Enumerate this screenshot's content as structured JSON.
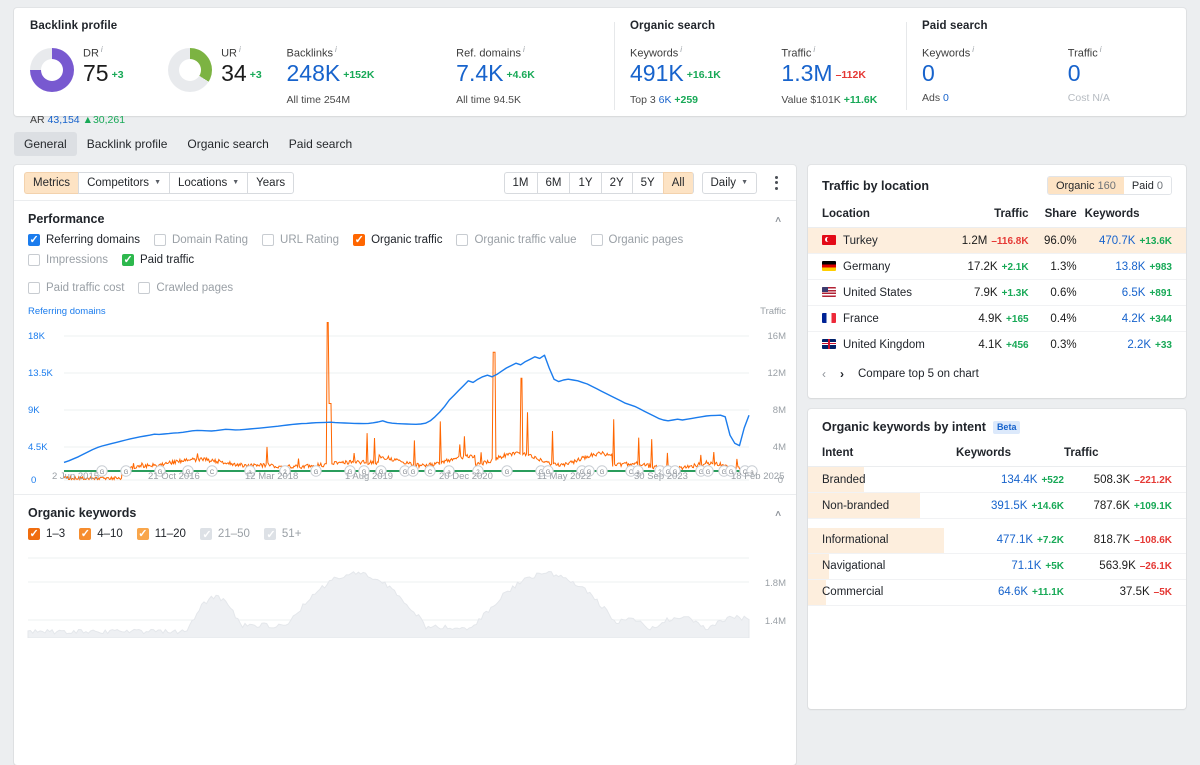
{
  "overview": {
    "groups": [
      {
        "title": "Backlink profile",
        "metrics": [
          {
            "label": "DR",
            "info": "i",
            "value": "75",
            "delta": "+3",
            "delta_dir": "up",
            "gauge_pct": 75,
            "gauge_color": "#7859d0",
            "sub_prefix": "AR",
            "sub_value": "43,154",
            "sub_delta": "▲30,261"
          },
          {
            "label": "UR",
            "info": "i",
            "value": "34",
            "delta": "+3",
            "delta_dir": "up",
            "gauge_pct": 34,
            "gauge_color": "#7cb342"
          },
          {
            "label": "Backlinks",
            "info": "i",
            "value": "248K",
            "delta": "+152K",
            "delta_dir": "up",
            "value_color": "blue",
            "sub_prefix": "All time",
            "sub_value": "254M"
          },
          {
            "label": "Ref. domains",
            "info": "i",
            "value": "7.4K",
            "delta": "+4.6K",
            "delta_dir": "up",
            "value_color": "blue",
            "sub_prefix": "All time",
            "sub_value": "94.5K"
          }
        ]
      },
      {
        "title": "Organic search",
        "metrics": [
          {
            "label": "Keywords",
            "info": "i",
            "value": "491K",
            "delta": "+16.1K",
            "delta_dir": "up",
            "value_color": "blue",
            "sub_prefix": "Top 3",
            "sub_value": "6K",
            "sub_delta": "+259"
          },
          {
            "label": "Traffic",
            "info": "i",
            "value": "1.3M",
            "delta": "–112K",
            "delta_dir": "down",
            "value_color": "blue",
            "sub_prefix": "Value",
            "sub_value": "$101K",
            "sub_delta": "+11.6K"
          }
        ]
      },
      {
        "title": "Paid search",
        "metrics": [
          {
            "label": "Keywords",
            "info": "i",
            "value": "0",
            "value_color": "blue",
            "sub_prefix": "Ads",
            "sub_value": "0"
          },
          {
            "label": "Traffic",
            "info": "i",
            "value": "0",
            "value_color": "blue",
            "sub_prefix": "Cost",
            "sub_value": "N/A",
            "sub_muted": true
          }
        ]
      }
    ]
  },
  "tabs": [
    {
      "label": "General",
      "active": true
    },
    {
      "label": "Backlink profile",
      "active": false
    },
    {
      "label": "Organic search",
      "active": false
    },
    {
      "label": "Paid search",
      "active": false
    }
  ],
  "toolbar": {
    "left_buttons": [
      {
        "label": "Metrics",
        "amber": true,
        "caret": false
      },
      {
        "label": "Competitors",
        "amber": false,
        "caret": true
      },
      {
        "label": "Locations",
        "amber": false,
        "caret": true
      },
      {
        "label": "Years",
        "amber": false,
        "caret": false
      }
    ],
    "ranges": [
      {
        "label": "1M",
        "active": false
      },
      {
        "label": "6M",
        "active": false
      },
      {
        "label": "1Y",
        "active": false
      },
      {
        "label": "2Y",
        "active": false
      },
      {
        "label": "5Y",
        "active": false
      },
      {
        "label": "All",
        "active": true
      }
    ],
    "granularity": {
      "label": "Daily",
      "caret": "▼"
    },
    "kebab": "more-options"
  },
  "performance": {
    "title": "Performance",
    "collapse_icon": "∧",
    "checkboxes": [
      {
        "label": "Referring domains",
        "checked": true,
        "color": "#1b7ced"
      },
      {
        "label": "Domain Rating",
        "checked": false,
        "color": ""
      },
      {
        "label": "URL Rating",
        "checked": false,
        "color": ""
      },
      {
        "label": "Organic traffic",
        "checked": true,
        "color": "#ff6600"
      },
      {
        "label": "Organic traffic value",
        "checked": false,
        "color": ""
      },
      {
        "label": "Organic pages",
        "checked": false,
        "color": ""
      },
      {
        "label": "Impressions",
        "checked": false,
        "color": ""
      },
      {
        "label": "Paid traffic",
        "checked": true,
        "color": "#2db84d"
      },
      {
        "label": "Paid traffic cost",
        "checked": false,
        "color": ""
      },
      {
        "label": "Crawled pages",
        "checked": false,
        "color": ""
      }
    ]
  },
  "organic_keywords": {
    "title": "Organic keywords",
    "collapse_icon": "∧",
    "checkboxes": [
      {
        "label": "1–3",
        "checked": true,
        "dim": false
      },
      {
        "label": "4–10",
        "checked": true,
        "dim": false
      },
      {
        "label": "11–20",
        "checked": true,
        "dim": false
      },
      {
        "label": "21–50",
        "checked": true,
        "dim": true
      },
      {
        "label": "51+",
        "checked": true,
        "dim": true
      }
    ],
    "y_labels": [
      "1.8M",
      "1.4M"
    ]
  },
  "traffic_by_location": {
    "title": "Traffic by location",
    "toggle": [
      {
        "label": "Organic",
        "count": "160",
        "active": true
      },
      {
        "label": "Paid",
        "count": "0",
        "active": false
      }
    ],
    "columns": [
      "Location",
      "Traffic",
      "Share",
      "Keywords"
    ],
    "rows": [
      {
        "flag": "tr",
        "location": "Turkey",
        "traffic": "1.2M",
        "traffic_delta": "–116.8K",
        "traffic_dir": "down",
        "share": "96.0%",
        "keywords": "470.7K",
        "kw_delta": "+13.6K",
        "kw_dir": "up",
        "highlight": true
      },
      {
        "flag": "de",
        "location": "Germany",
        "traffic": "17.2K",
        "traffic_delta": "+2.1K",
        "traffic_dir": "up",
        "share": "1.3%",
        "keywords": "13.8K",
        "kw_delta": "+983",
        "kw_dir": "up",
        "highlight": false
      },
      {
        "flag": "us",
        "location": "United States",
        "traffic": "7.9K",
        "traffic_delta": "+1.3K",
        "traffic_dir": "up",
        "share": "0.6%",
        "keywords": "6.5K",
        "kw_delta": "+891",
        "kw_dir": "up",
        "highlight": false
      },
      {
        "flag": "fr",
        "location": "France",
        "traffic": "4.9K",
        "traffic_delta": "+165",
        "traffic_dir": "up",
        "share": "0.4%",
        "keywords": "4.2K",
        "kw_delta": "+344",
        "kw_dir": "up",
        "highlight": false
      },
      {
        "flag": "gb",
        "location": "United Kingdom",
        "traffic": "4.1K",
        "traffic_delta": "+456",
        "traffic_dir": "up",
        "share": "0.3%",
        "keywords": "2.2K",
        "kw_delta": "+33",
        "kw_dir": "up",
        "highlight": false
      }
    ],
    "pager": {
      "prev": "‹",
      "next": "›",
      "label": "Compare top 5 on chart"
    }
  },
  "organic_keywords_by_intent": {
    "title": "Organic keywords by intent",
    "badge": "Beta",
    "columns": [
      "Intent",
      "Keywords",
      "Traffic"
    ],
    "rows": [
      {
        "intent": "Branded",
        "keywords": "134.4K",
        "kw_delta": "+522",
        "kw_dir": "up",
        "traffic": "508.3K",
        "tr_delta": "–221.2K",
        "tr_dir": "down",
        "bar_pct": 38
      },
      {
        "intent": "Non-branded",
        "keywords": "391.5K",
        "kw_delta": "+14.6K",
        "kw_dir": "up",
        "traffic": "787.6K",
        "tr_delta": "+109.1K",
        "tr_dir": "up",
        "bar_pct": 76
      },
      {
        "intent": "Informational",
        "keywords": "477.1K",
        "kw_delta": "+7.2K",
        "kw_dir": "up",
        "traffic": "818.7K",
        "tr_delta": "–108.6K",
        "tr_dir": "down",
        "bar_pct": 92
      },
      {
        "intent": "Navigational",
        "keywords": "71.1K",
        "kw_delta": "+5K",
        "kw_dir": "up",
        "traffic": "563.9K",
        "tr_delta": "–26.1K",
        "tr_dir": "down",
        "bar_pct": 14
      },
      {
        "intent": "Commercial",
        "keywords": "64.6K",
        "kw_delta": "+11.1K",
        "kw_dir": "up",
        "traffic": "37.5K",
        "tr_delta": "–5K",
        "tr_dir": "down",
        "bar_pct": 12
      }
    ]
  },
  "chart_data": {
    "type": "line",
    "title": "Performance",
    "legend_left": "Referring domains",
    "legend_right": "Traffic",
    "ylabel_left": "Referring domains",
    "ylabel_right": "Traffic",
    "ylim_left": [
      0,
      18000
    ],
    "yticks_left": [
      "0",
      "4.5K",
      "9K",
      "13.5K",
      "18K"
    ],
    "ylim_right": [
      0,
      16000000
    ],
    "yticks_right": [
      "0",
      "4M",
      "8M",
      "12M",
      "16M"
    ],
    "xlabel": "",
    "xticks": [
      "2 Jun 2015",
      "21 Oct 2016",
      "12 Mar 2018",
      "1 Aug 2019",
      "20 Dec 2020",
      "11 May 2022",
      "30 Sep 2023",
      "18 Feb 2025"
    ],
    "grid": true,
    "legend_position": "top",
    "series": [
      {
        "name": "Referring domains",
        "color": "#1b7ced",
        "axis": "left",
        "values": [
          2200,
          2400,
          2650,
          2900,
          3200,
          3500,
          3800,
          4050,
          4250,
          4400,
          4550,
          4700,
          4850,
          5000,
          5150,
          5280,
          5400,
          5500,
          5600,
          5720,
          5700,
          5750,
          5800,
          5860,
          5900,
          5960,
          6050,
          6150,
          6200,
          6180,
          6150,
          6130,
          6180,
          6260,
          6340,
          6300,
          6260,
          6280,
          6320,
          6380,
          6420,
          6480,
          6540,
          6600,
          6660,
          6720,
          6800,
          6880,
          6950,
          7000,
          7050,
          7080,
          7120,
          7160,
          7180,
          7200,
          7220,
          7180,
          7150,
          7120,
          7100,
          7080,
          7060,
          7050,
          7080,
          7150,
          7250,
          7400,
          7200,
          7100,
          7050,
          7020,
          7000,
          6980,
          6960,
          7000,
          7100,
          7400,
          7900,
          8500,
          9200,
          10000,
          10600,
          11200,
          11800,
          12400,
          12200,
          12600,
          12900,
          13100,
          12900,
          13200,
          13600,
          14000,
          14300,
          14600,
          14400,
          14800,
          15100,
          15400,
          15200,
          15600,
          14000,
          12600,
          12300,
          12500,
          12600,
          12500,
          12400,
          12200,
          12000,
          11700,
          11400,
          11100,
          10800,
          10500,
          10200,
          9900,
          9600,
          9400,
          9200,
          8900,
          8600,
          8300,
          8000,
          7700,
          7500,
          7400,
          7500,
          7600,
          7500,
          7600,
          7700,
          7800,
          7900,
          8000,
          8050,
          8080,
          8100,
          7900,
          5600,
          4600,
          4300,
          6500,
          8100
        ]
      },
      {
        "name": "Organic traffic",
        "color": "#ff6600",
        "axis": "right",
        "note": "highly spiky daily series, baseline ~1.2M-2M with frequent sharp spikes; largest spike ~17.5M at mid-2019, secondary spikes ~14M and ~11M in 2022"
      },
      {
        "name": "Google updates",
        "color": "#2a9d5c",
        "axis": "none",
        "note": "green baseline track with circular Google-update markers along the x-axis"
      }
    ]
  }
}
